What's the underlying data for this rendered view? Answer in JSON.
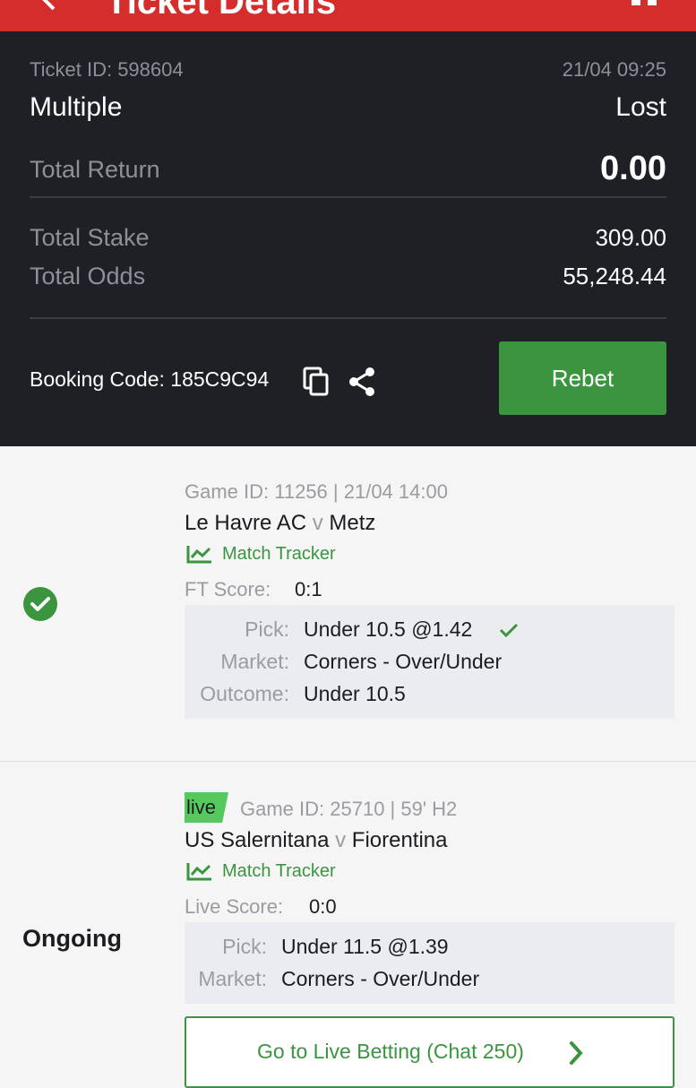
{
  "header": {
    "title": "Ticket Details"
  },
  "ticket": {
    "id_label": "Ticket ID: 598604",
    "datetime": "21/04 09:25",
    "type": "Multiple",
    "status": "Lost",
    "total_return_label": "Total Return",
    "total_return_value": "0.00",
    "total_stake_label": "Total Stake",
    "total_stake_value": "309.00",
    "total_odds_label": "Total Odds",
    "total_odds_value": "55,248.44",
    "booking_code": "Booking Code: 185C9C94",
    "rebet_label": "Rebet"
  },
  "selections": [
    {
      "game_info": "Game ID: 11256 | 21/04 14:00",
      "home": "Le Havre AC",
      "vs": "v",
      "away": "Metz",
      "tracker": "Match Tracker",
      "score_label": "FT Score:",
      "score_value": "0:1",
      "pick_label": "Pick:",
      "pick_value": "Under 10.5 @1.42",
      "market_label": "Market:",
      "market_value": "Corners - Over/Under",
      "outcome_label": "Outcome:",
      "outcome_value": "Under 10.5",
      "status_icon": "check-circle-icon"
    },
    {
      "badge": "live",
      "game_info": "Game ID: 25710 | 59' H2",
      "home": "US Salernitana",
      "vs": "v",
      "away": "Fiorentina",
      "tracker": "Match Tracker",
      "score_label": "Live Score:",
      "score_value": "0:0",
      "pick_label": "Pick:",
      "pick_value": "Under 11.5 @1.39",
      "market_label": "Market:",
      "market_value": "Corners - Over/Under",
      "status_text": "Ongoing",
      "go_live_label": "Go to Live Betting (Chat 250)"
    }
  ],
  "colors": {
    "header_red": "#d52c2c",
    "summary_bg": "#1e2026",
    "accent_green": "#3b953f",
    "live_green": "#56c95e"
  }
}
